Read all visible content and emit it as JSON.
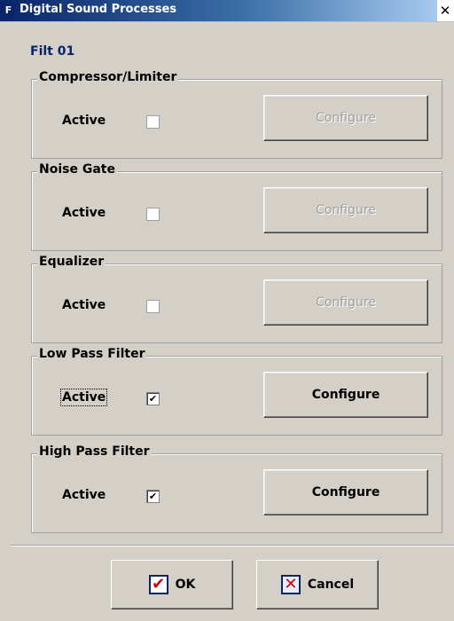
{
  "window": {
    "title": "Digital Sound Processes",
    "app_icon": "F",
    "close_glyph": "✕"
  },
  "subtitle": "Filt 01",
  "groups": [
    {
      "label": "Compressor/Limiter",
      "active_label": "Active",
      "checked": false,
      "enabled": false,
      "configure_label": "Configure"
    },
    {
      "label": "Noise Gate",
      "active_label": "Active",
      "checked": false,
      "enabled": false,
      "configure_label": "Configure"
    },
    {
      "label": "Equalizer",
      "active_label": "Active",
      "checked": false,
      "enabled": false,
      "configure_label": "Configure"
    },
    {
      "label": "Low Pass Filter",
      "active_label": "Active",
      "checked": true,
      "enabled": true,
      "configure_label": "Configure"
    },
    {
      "label": "High Pass Filter",
      "active_label": "Active",
      "checked": true,
      "enabled": true,
      "configure_label": "Configure"
    }
  ],
  "buttons": {
    "ok_label": "OK",
    "cancel_label": "Cancel"
  },
  "icons": {
    "ok": "checkmark-icon",
    "cancel": "x-icon"
  }
}
